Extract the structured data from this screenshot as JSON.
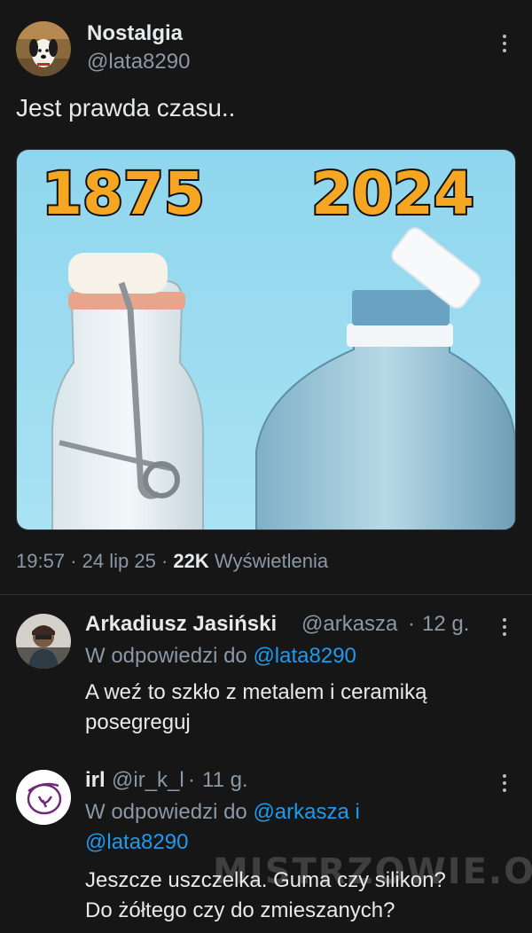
{
  "colors": {
    "background": "#161616",
    "text": "#e7e9ea",
    "muted": "#8b98a5",
    "link": "#1d9bf0",
    "year_label": "#f5a623"
  },
  "post": {
    "author_name": "Nostalgia",
    "author_handle": "@lata8290",
    "text": "Jest prawda czasu..",
    "image": {
      "left_year": "1875",
      "right_year": "2024"
    },
    "time": "19:57",
    "date": "24 lip 25",
    "views_count": "22K",
    "views_label": "Wyświetlenia"
  },
  "replies": [
    {
      "author_name": "Arkadiusz Jasiński",
      "author_handle": "@arkasza",
      "age": "12 g.",
      "reply_to_prefix": "W odpowiedzi do",
      "reply_to_1": "@lata8290",
      "text_line_1": "A weź to szkło z metalem i ceramiką",
      "text_line_2": "posegreguj"
    },
    {
      "author_name": "irl",
      "author_handle": "@ir_k_l",
      "age": "11 g.",
      "reply_to_prefix": "W odpowiedzi do",
      "reply_to_1": "@arkasza",
      "reply_to_joiner": "i",
      "reply_to_2": "@lata8290",
      "text_line_1": "Jeszcze uszczelka. Guma czy silikon?",
      "text_line_2": "Do żółtego czy do zmieszanych?"
    }
  ],
  "watermark": "MISTRZOWIE.ORG",
  "icons": {
    "menu": "more-vertical-icon"
  }
}
